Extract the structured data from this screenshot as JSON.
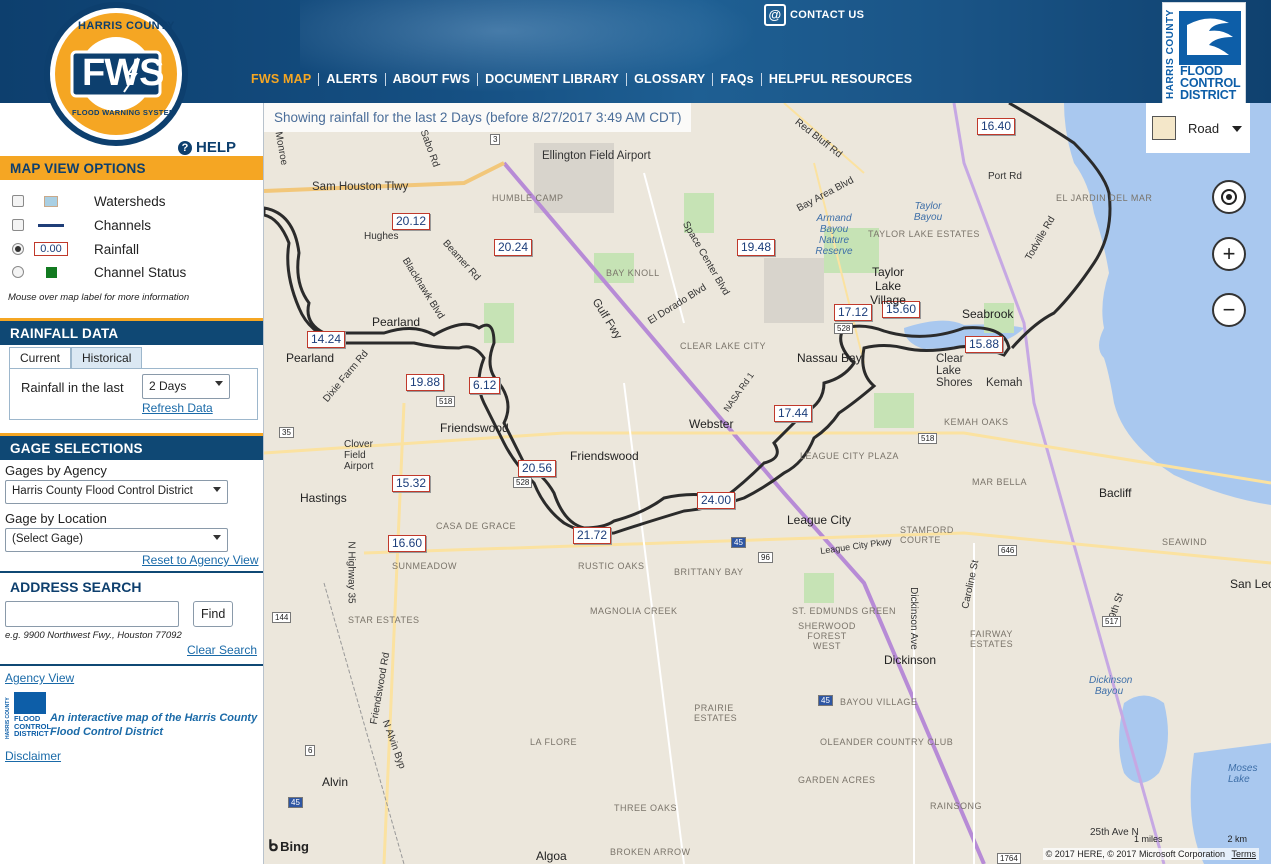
{
  "header": {
    "logo": {
      "top_text": "HARRIS COUNTY",
      "main_text": "FWS",
      "bottom_text": "FLOOD WARNING SYSTEM"
    },
    "contact_label": "CONTACT US",
    "nav": [
      {
        "label": "FWS MAP",
        "active": true
      },
      {
        "label": "ALERTS",
        "active": false
      },
      {
        "label": "ABOUT FWS",
        "active": false
      },
      {
        "label": "DOCUMENT LIBRARY",
        "active": false
      },
      {
        "label": "GLOSSARY",
        "active": false
      },
      {
        "label": "FAQs",
        "active": false
      },
      {
        "label": "HELPFUL RESOURCES",
        "active": false
      }
    ],
    "hcfcd_logo": {
      "vertical": "HARRIS COUNTY",
      "line1": "FLOOD",
      "line2": "CONTROL",
      "line3": "DISTRICT"
    }
  },
  "sidebar": {
    "help_label": "HELP",
    "map_view_options": {
      "title": "MAP VIEW OPTIONS",
      "items": [
        {
          "label": "Watersheds",
          "control": "checkbox",
          "checked": false
        },
        {
          "label": "Channels",
          "control": "checkbox",
          "checked": false
        },
        {
          "label": "Rainfall",
          "control": "radio",
          "checked": true,
          "sample": "0.00"
        },
        {
          "label": "Channel Status",
          "control": "radio",
          "checked": false
        }
      ],
      "hint": "Mouse over map label for more information"
    },
    "rainfall_data": {
      "title": "RAINFALL DATA",
      "tabs": [
        "Current",
        "Historical"
      ],
      "active_tab": "Current",
      "label": "Rainfall in the last",
      "selected": "2 Days",
      "refresh_label": "Refresh Data"
    },
    "gage_selections": {
      "title": "GAGE SELECTIONS",
      "agency_label": "Gages by Agency",
      "agency_selected": "Harris County Flood Control District",
      "location_label": "Gage by Location",
      "location_selected": "(Select Gage)",
      "reset_label": "Reset to Agency View"
    },
    "address_search": {
      "title": "ADDRESS SEARCH",
      "input_value": "",
      "find_label": "Find",
      "example": "e.g. 9900 Northwest Fwy., Houston 77092",
      "clear_label": "Clear Search"
    },
    "footer": {
      "agency_view": "Agency View",
      "tagline": "An interactive map of the Harris County Flood Control District",
      "disclaimer": "Disclaimer",
      "logo": {
        "vertical": "HARRIS COUNTY",
        "line1": "FLOOD",
        "line2": "CONTROL",
        "line3": "DISTRICT"
      }
    }
  },
  "map": {
    "banner": "Showing rainfall for the last 2 Days (before 8/27/2017 3:49 AM CDT)",
    "style_selector": "Road",
    "gages": [
      "16.40",
      "20.12",
      "20.24",
      "19.48",
      "17.12",
      "15.60",
      "15.88",
      "14.24",
      "19.88",
      "6.12",
      "17.44",
      "20.56",
      "15.32",
      "24.00",
      "21.72",
      "16.60"
    ],
    "places": [
      "Sam Houston Tlwy",
      "Ellington Field Airport",
      "HUMBLE CAMP",
      "Pearland",
      "Friendswood",
      "Webster",
      "Nassau Bay",
      "Taylor Lake Village",
      "Seabrook",
      "Clear Lake Shores",
      "Kemah",
      "League City",
      "Bacliff",
      "Hastings",
      "Clover Field Airport",
      "Dickinson",
      "Alvin",
      "Algoa",
      "San Leon",
      "Gulf Fwy",
      "CLEAR LAKE CITY",
      "BAY KNOLL",
      "KEMAH OAKS",
      "MAR BELLA",
      "STAMFORD COURTE",
      "SEAWIND",
      "BRITTANY BAY",
      "MAGNOLIA CREEK",
      "ST. EDMUNDS GREEN",
      "SHERWOOD FOREST WEST",
      "BAYOU VILLAGE",
      "OLEANDER COUNTRY CLUB",
      "LA FLORE",
      "GARDEN ACRES",
      "THREE OAKS",
      "RAINSONG",
      "BROKEN ARROW",
      "PRAIRIE ESTATES",
      "RUSTIC OAKS",
      "SUNMEADOW",
      "CASA DE GRACE",
      "STAR ESTATES",
      "FAIRWAY ESTATES",
      "LEAGUE CITY PLAZA",
      "Taylor Bayou",
      "Armand Bayou Nature Reserve",
      "Dickinson Bayou",
      "Moses Lake",
      "EL JARDIN DEL MAR",
      "TAYLOR LAKE ESTATES",
      "Red Bluff Rd",
      "Port Rd",
      "Bay Area Blvd",
      "Space Center Blvd",
      "Beamer Rd",
      "Blackhawk Blvd",
      "Hughes",
      "Sabo Rd",
      "Monroe",
      "Dixie Farm Rd",
      "N Highway 35",
      "Friendswood Rd",
      "N Alvin Byp",
      "Dickinson Ave",
      "Caroline St",
      "29th St",
      "League City Pkwy",
      "El Dorado Blvd",
      "Todville Rd",
      "NASA Rd 1",
      "25th Ave N"
    ],
    "controls": {
      "locate": "locate-me",
      "zoom_in": "+",
      "zoom_out": "−"
    },
    "attribution": {
      "bing": "Bing",
      "copyright": "© 2017 HERE, © 2017 Microsoft Corporation",
      "terms": "Terms",
      "scale_miles": "1 miles",
      "scale_km": "2 km"
    },
    "shields": [
      "3",
      "528",
      "518",
      "35",
      "528",
      "518",
      "96",
      "646",
      "517",
      "144",
      "45",
      "45",
      "6",
      "1764",
      "45"
    ]
  },
  "colors": {
    "header_dark": "#0d3f6e",
    "accent_orange": "#f5a623",
    "gage_border": "#c0392b",
    "gage_text": "#1b3d7a",
    "water": "#a9c8ef",
    "watershed_line": "#2b2b2b",
    "freeway": "#b78bd6"
  }
}
